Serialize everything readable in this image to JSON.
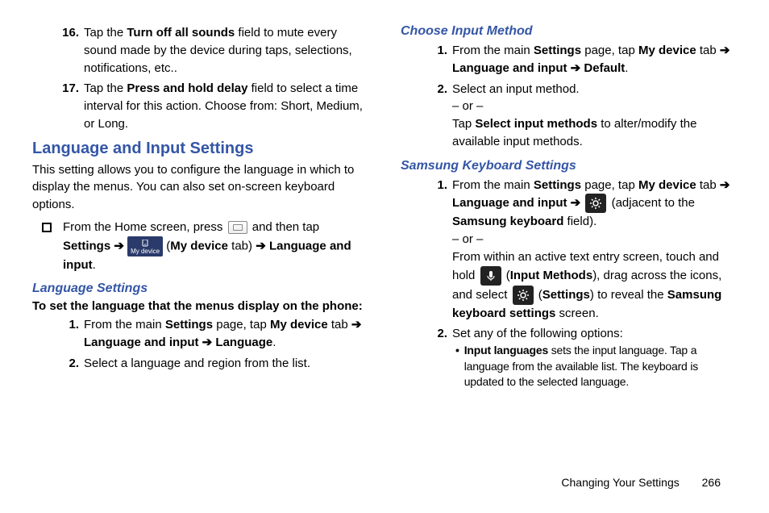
{
  "left": {
    "item16": {
      "num": "16.",
      "pre": "Tap the ",
      "bold1": "Turn off all sounds",
      "post": " field to mute every sound made by the device during taps, selections, notifications, etc.."
    },
    "item17": {
      "num": "17.",
      "pre": "Tap the ",
      "bold1": "Press and hold delay",
      "post": " field to select a time interval for this action. Choose from: Short, Medium, or Long."
    },
    "heading1": "Language and Input Settings",
    "intro": "This setting allows you to configure the language in which to display the menus. You can also set on-screen keyboard options.",
    "homeStep": {
      "pre": "From the Home screen, press ",
      "mid1": " and then tap ",
      "bold1": "Settings",
      "arrow1": " ➔ ",
      "mydevLabel": "My device",
      "paren1": " (",
      "bold2": "My device",
      "tab": " tab) ",
      "arrow2": "➔ ",
      "bold3": "Language and input",
      "period": "."
    },
    "sub1": "Language Settings",
    "sub1Instr": "To set the language that the menus display on the phone:",
    "step1": {
      "num": "1.",
      "pre": "From the main ",
      "b1": "Settings",
      "mid1": " page, tap ",
      "b2": "My device",
      "mid2": " tab ",
      "arrow1": "➔ ",
      "b3": "Language and input",
      "arrow2": " ➔ ",
      "b4": "Language",
      "post": "."
    },
    "step2": {
      "num": "2.",
      "text": "Select a language and region from the list."
    }
  },
  "right": {
    "sub1": "Choose Input Method",
    "r1": {
      "num": "1.",
      "pre": "From the main ",
      "b1": "Settings",
      "mid1": " page, tap ",
      "b2": "My device",
      "mid2": " tab ",
      "arrow1": "➔ ",
      "b3": "Language and input ",
      "arrow2": " ➔ ",
      "b4": "Default",
      "post": "."
    },
    "r2": {
      "num": "2.",
      "line1": "Select an input method.",
      "or": "– or –",
      "pre": "Tap ",
      "b1": "Select input methods",
      "post": " to alter/modify the available input methods."
    },
    "sub2": "Samsung Keyboard Settings",
    "s1": {
      "num": "1.",
      "pre": "From the main ",
      "b1": "Settings",
      "mid1": " page, tap ",
      "b2": "My device",
      "mid2": " tab ",
      "arrow1": "➔ ",
      "b3": "Language and input",
      "arrow2": " ➔ ",
      "adj1": " (adjacent to the ",
      "b4": "Samsung keyboard",
      "adj2": " field).",
      "or": "– or –",
      "line3a": "From within an active text entry screen, touch and hold ",
      "paren1": " (",
      "b5": "Input Methods",
      "mid3": "), drag across the icons, and select ",
      "paren2": " (",
      "b6": "Settings",
      "mid4": ") to reveal the ",
      "b7": "Samsung keyboard settings",
      "post": " screen."
    },
    "s2": {
      "num": "2.",
      "text": "Set any of the following options:",
      "bullet": {
        "b1": "Input languages",
        "rest": " sets the input language. Tap a language from the available list. The keyboard is updated to the selected language."
      }
    }
  },
  "footer": {
    "section": "Changing Your Settings",
    "page": "266"
  }
}
